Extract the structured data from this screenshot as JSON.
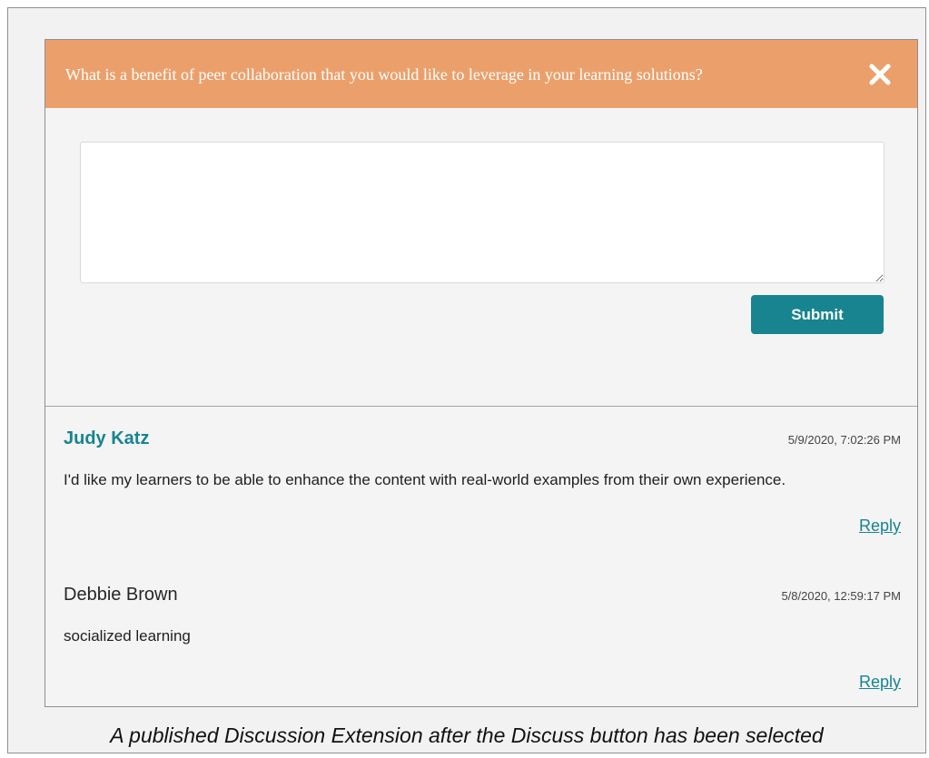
{
  "dialog": {
    "question": "What is a benefit of peer collaboration that you would like to leverage in your learning solutions?",
    "close_icon": "close-icon",
    "response_field": {
      "value": "",
      "placeholder": ""
    },
    "submit_label": "Submit"
  },
  "comments": [
    {
      "author": "Judy Katz",
      "timestamp": "5/9/2020, 7:02:26 PM",
      "body": "I'd like my learners to be able to enhance the content with real-world examples from their own experience.",
      "reply_label": "Reply"
    },
    {
      "author": "Debbie Brown",
      "timestamp": "5/8/2020, 12:59:17 PM",
      "body": "socialized learning",
      "reply_label": "Reply"
    }
  ],
  "caption": "A published Discussion Extension after the Discuss button has been selected",
  "colors": {
    "header_background": "#eba06c",
    "accent": "#178490",
    "panel_background": "#f4f4f4"
  }
}
